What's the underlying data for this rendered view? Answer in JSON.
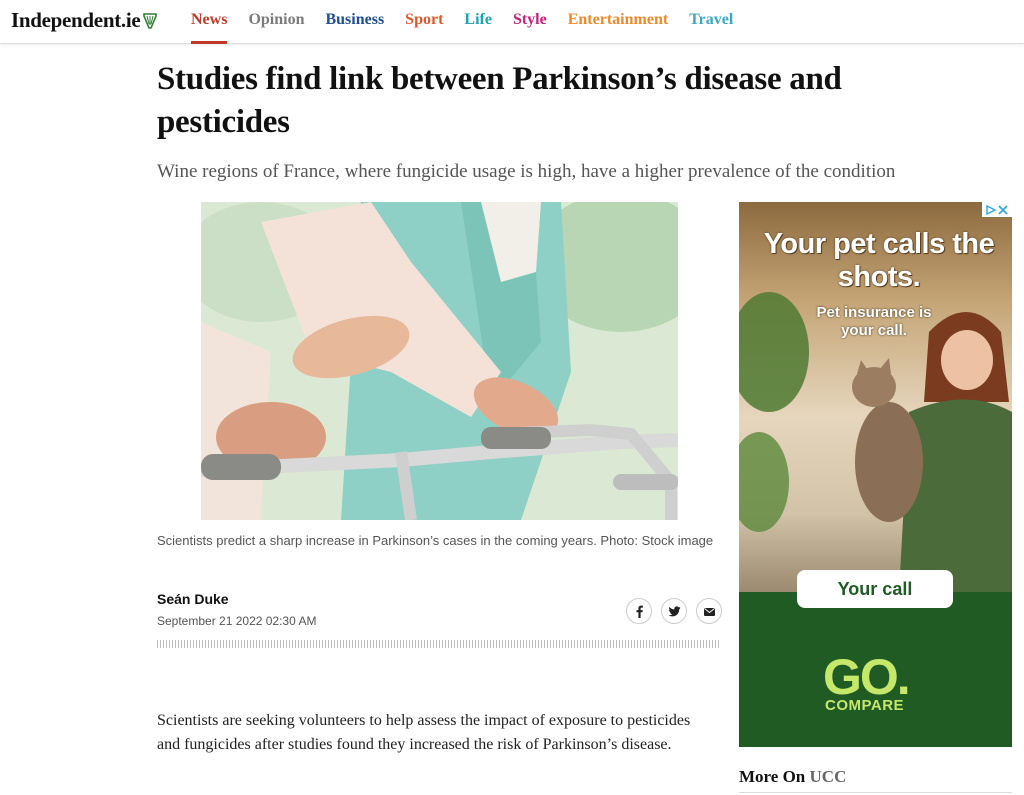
{
  "site": {
    "logo": "Independent.ie"
  },
  "nav": [
    {
      "label": "News",
      "color": "#c0392b",
      "active": true
    },
    {
      "label": "Opinion",
      "color": "#7b7b7b"
    },
    {
      "label": "Business",
      "color": "#1f4f8f"
    },
    {
      "label": "Sport",
      "color": "#e0562a"
    },
    {
      "label": "Life",
      "color": "#1fa4b5"
    },
    {
      "label": "Style",
      "color": "#c2237a"
    },
    {
      "label": "Entertainment",
      "color": "#ef8a2a"
    },
    {
      "label": "Travel",
      "color": "#39a9c9"
    }
  ],
  "article": {
    "headline": "Studies find link between Parkinson’s disease and pesticides",
    "standfirst": "Wine regions of France, where fungicide usage is high, have a higher prevalence of the condition",
    "caption": "Scientists predict a sharp increase in Parkinson’s cases in the coming years. Photo: Stock image",
    "author": "Seán Duke",
    "date": "September 21 2022 02:30 AM",
    "body": "Scientists are seeking volunteers to help assess the impact of exposure to pesticides and fungicides after studies found they increased the risk of Parkinson’s disease."
  },
  "share": {
    "icons": [
      "facebook-icon",
      "twitter-icon",
      "email-icon"
    ]
  },
  "ad": {
    "headline": "Your pet calls the shots.",
    "subline": "Pet insurance is your call.",
    "button": "Your call",
    "brand_big": "GO.",
    "brand_small": "COMPARE"
  },
  "more_on": {
    "label": "More On",
    "topic": "UCC"
  }
}
